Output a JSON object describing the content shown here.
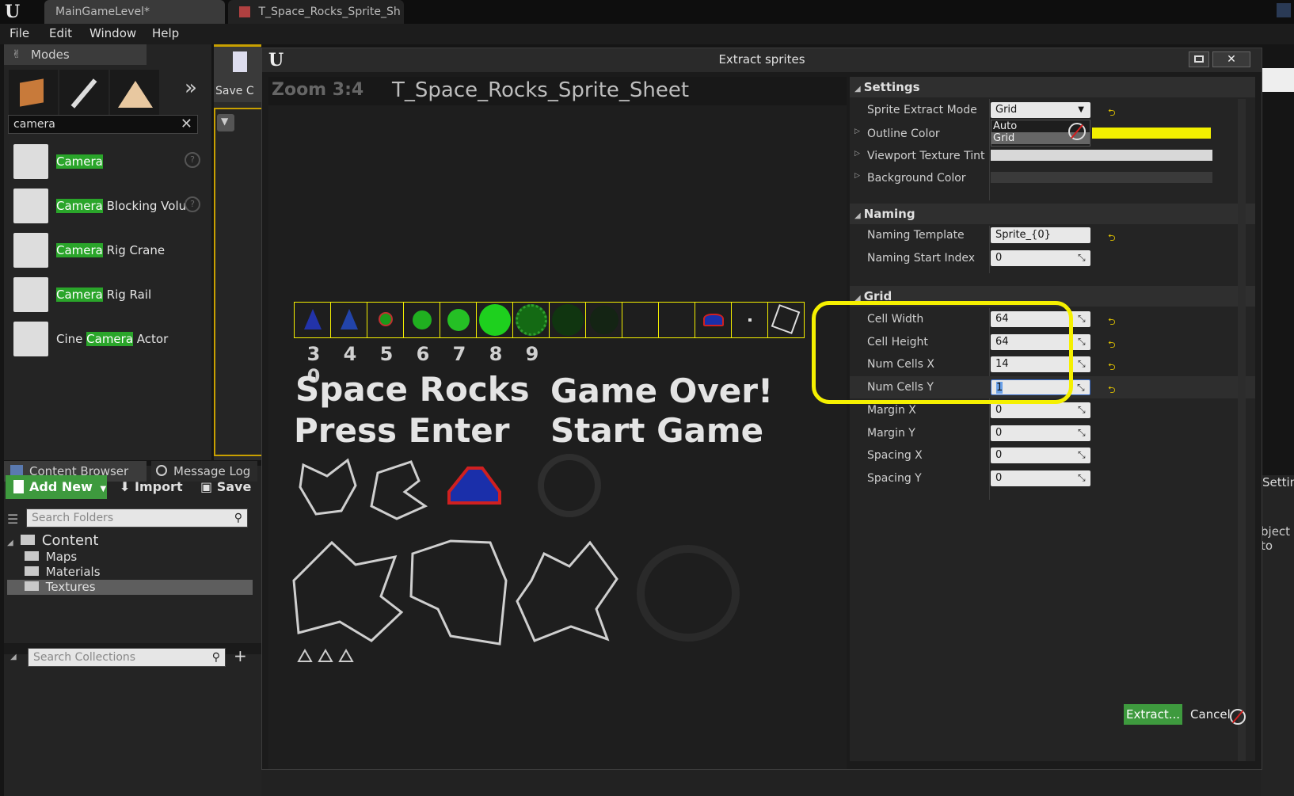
{
  "titlebar": {
    "tabs": [
      "MainGameLevel*",
      "T_Space_Rocks_Sprite_Sh"
    ],
    "tab_close": "×"
  },
  "menu": [
    "File",
    "Edit",
    "Window",
    "Help"
  ],
  "modes": {
    "title": "Modes",
    "more_glyph": "»",
    "search_value": "camera",
    "items": [
      {
        "highlight": "Camera",
        "rest": "",
        "help": "?"
      },
      {
        "highlight": "Camera",
        "rest": " Blocking Volu",
        "help": "?"
      },
      {
        "highlight": "Camera",
        "rest": " Rig Crane",
        "help": ""
      },
      {
        "highlight": "Camera",
        "rest": " Rig Rail",
        "help": ""
      },
      {
        "prefix": "Cine ",
        "highlight": "Camera",
        "rest": " Actor",
        "help": ""
      }
    ]
  },
  "viewport": {
    "save_label": "Save C"
  },
  "content_browser": {
    "tabs": [
      "Content Browser",
      "Message Log"
    ],
    "add_new": "Add New",
    "import": "Import",
    "save": "Save",
    "search_folders_placeholder": "Search Folders",
    "tree": {
      "root": "Content",
      "children": [
        "Maps",
        "Materials",
        "Textures"
      ]
    },
    "search_collections_placeholder": "Search Collections"
  },
  "dialog": {
    "title": "Extract sprites",
    "zoom": "Zoom 3:4",
    "texture_name": "T_Space_Rocks_Sprite_Sheet",
    "digits": [
      "3",
      "4",
      "5",
      "6",
      "7",
      "8",
      "9",
      "0"
    ],
    "sheet_text": [
      "Space Rocks",
      "Press Enter",
      "Game Over!",
      "Start Game"
    ],
    "settings": {
      "header": "Settings",
      "sprite_extract_mode_label": "Sprite Extract Mode",
      "sprite_extract_mode_value": "Grid",
      "dropdown_options": [
        "Auto",
        "Grid"
      ],
      "outline_color_label": "Outline Color",
      "viewport_tint_label": "Viewport Texture Tint",
      "background_color_label": "Background Color",
      "colors": {
        "outline": "#f2f000",
        "tint": "#d8d8d8",
        "background": "#3a3a3a"
      }
    },
    "naming": {
      "header": "Naming",
      "template_label": "Naming Template",
      "template_value": "Sprite_{0}",
      "start_index_label": "Naming Start Index",
      "start_index_value": "0"
    },
    "grid": {
      "header": "Grid",
      "cell_width_label": "Cell Width",
      "cell_width": "64",
      "cell_height_label": "Cell Height",
      "cell_height": "64",
      "num_cells_x_label": "Num Cells X",
      "num_cells_x": "14",
      "num_cells_y_label": "Num Cells Y",
      "num_cells_y": "1",
      "margin_x_label": "Margin X",
      "margin_x": "0",
      "margin_y_label": "Margin Y",
      "margin_y": "0",
      "spacing_x_label": "Spacing X",
      "spacing_x": "0",
      "spacing_y_label": "Spacing Y",
      "spacing_y": "0"
    },
    "extract_button": "Extract...",
    "cancel_button": "Cancel"
  },
  "right_panel": {
    "settings_tab": "Settin",
    "object_text": "bject to"
  }
}
